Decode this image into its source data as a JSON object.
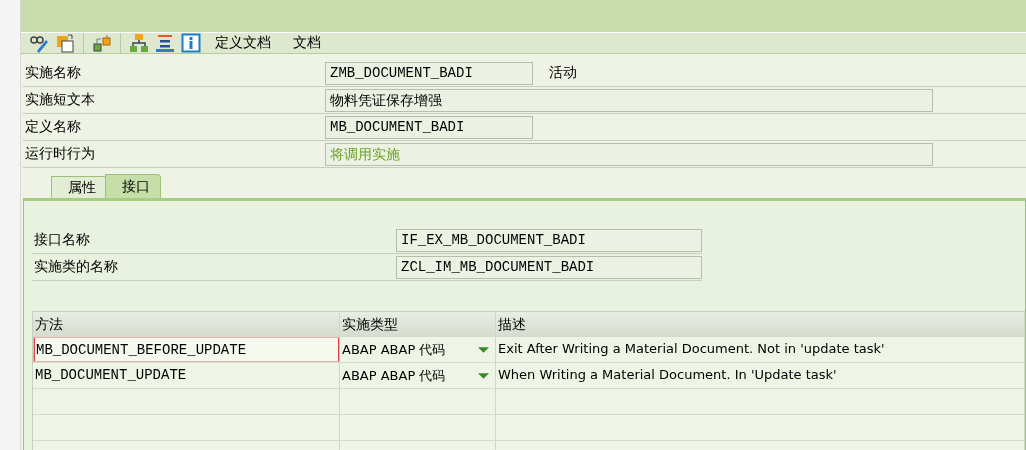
{
  "toolbar": {
    "icons": [
      {
        "kind": "display-change"
      },
      {
        "kind": "copy"
      },
      {
        "kind": "separator"
      },
      {
        "kind": "objects"
      },
      {
        "kind": "separator"
      },
      {
        "kind": "hierarchy"
      },
      {
        "kind": "lines"
      },
      {
        "kind": "info"
      }
    ],
    "buttons": [
      "定义文档",
      "文档"
    ]
  },
  "header_fields": [
    {
      "label": "实施名称",
      "value": "ZMB_DOCUMENT_BADI",
      "status": "活动",
      "kind": "code"
    },
    {
      "label": "实施短文本",
      "value": "物料凭证保存增强",
      "kind": "text"
    },
    {
      "label": "定义名称",
      "value": "MB_DOCUMENT_BADI",
      "kind": "code"
    },
    {
      "label": "运行时行为",
      "value": "将调用实施",
      "kind": "info"
    }
  ],
  "tabs": [
    {
      "label": "属性",
      "selected": false
    },
    {
      "label": "接口",
      "selected": true
    }
  ],
  "interface_fields": [
    {
      "label": "接口名称",
      "value": "IF_EX_MB_DOCUMENT_BADI"
    },
    {
      "label": "实施类的名称",
      "value": "ZCL_IM_MB_DOCUMENT_BADI"
    }
  ],
  "table": {
    "columns": [
      "方法",
      "实施类型",
      "描述"
    ],
    "rows": [
      {
        "method": "MB_DOCUMENT_BEFORE_UPDATE",
        "type": "ABAP ABAP 代码",
        "description": "Exit After Writing a Material Document. Not in 'update task'",
        "focused": true
      },
      {
        "method": "MB_DOCUMENT_UPDATE",
        "type": "ABAP ABAP 代码",
        "description": "When Writing a Material Document. In 'Update task'",
        "focused": false
      }
    ]
  }
}
